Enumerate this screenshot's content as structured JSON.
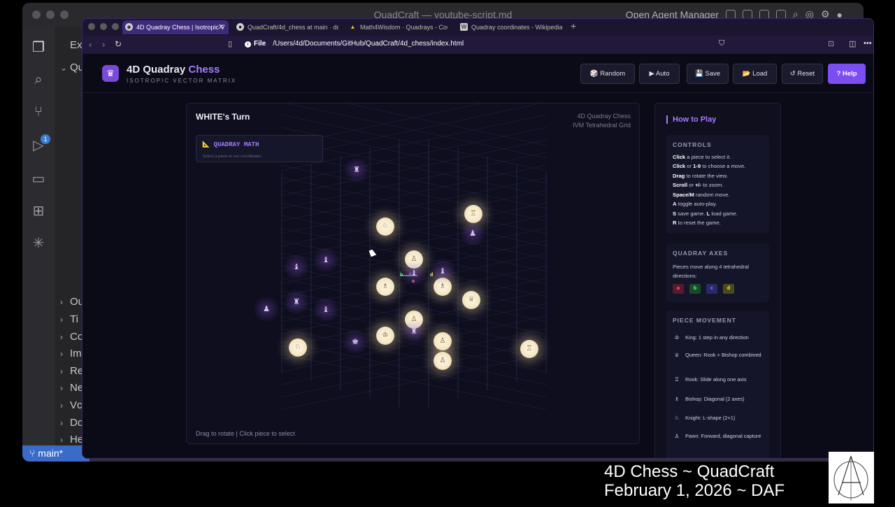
{
  "vscode": {
    "window_title": "QuadCraft — youtube-script.md",
    "right_label": "Open Agent Manager",
    "scm_badge": "1",
    "sidebar_header": "Ex",
    "sidebar_rows": [
      "Qu",
      "Ou",
      "Ti",
      "Co",
      "Im",
      "Re",
      "Ne",
      "Vc",
      "Do",
      "He"
    ],
    "branch": "main*"
  },
  "browser": {
    "tabs": [
      {
        "title": "4D Quadray Chess | Isotropic V",
        "icon": "chess-favicon",
        "active": true
      },
      {
        "title": "QuadCraft/4d_chess at main · doc",
        "icon": "github-icon",
        "active": false
      },
      {
        "title": "Math4Wisdom · Quadrays - Coda",
        "icon": "coda-icon",
        "active": false
      },
      {
        "title": "Quadray coordinates - Wikipedia",
        "icon": "wikipedia-icon",
        "active": false
      }
    ],
    "url_scheme": "File",
    "url": "/Users/4d/Documents/GitHub/QuadCraft/4d_chess/index.html"
  },
  "app": {
    "logo_icon": "♛",
    "title_main": "4D Quadray ",
    "title_accent": "Chess",
    "subtitle": "ISOTROPIC VECTOR MATRIX",
    "buttons": {
      "random": "🎲 Random",
      "auto": "▶ Auto",
      "save": "💾 Save",
      "load": "📂 Load",
      "reset": "↺ Reset",
      "help": "? Help"
    },
    "colors": {
      "accent": "#a77bff",
      "help_button": "#7c4df0"
    }
  },
  "board": {
    "turn": "WHITE's Turn",
    "meta_line1": "4D Quadray Chess",
    "meta_line2": "IVM Tetrahedral Grid",
    "quadray_math_title": "📐 QUADRAY MATH",
    "quadray_math_sub": "Select a piece to see coordinates",
    "hint": "Drag to rotate | Click piece to select",
    "axis_labels": {
      "a": "a",
      "b": "b",
      "c": "c",
      "d": "d"
    }
  },
  "help": {
    "title": "How to Play",
    "controls_header": "CONTROLS",
    "controls": [
      {
        "key": "Click",
        "text": " a piece to select it."
      },
      {
        "key": "Click",
        "text": " or ",
        "key2": "1-9",
        "text2": " to choose a move."
      },
      {
        "key": "Drag",
        "text": " to rotate the view."
      },
      {
        "key": "Scroll",
        "text": " or ",
        "key2": "+/-",
        "text2": " to zoom."
      },
      {
        "key": "Space/M",
        "text": " random move."
      },
      {
        "key": "A",
        "text": " toggle auto-play."
      },
      {
        "key": "S",
        "text": " save game. ",
        "key2": "L",
        "text2": " load game."
      },
      {
        "key": "R",
        "text": " to reset the game."
      }
    ],
    "axes_header": "QUADRAY AXES",
    "axes_desc": "Pieces move along 4 tetrahedral directions:",
    "axes": [
      {
        "label": "a",
        "bg": "#5a1a2a",
        "fg": "#ff6b8a"
      },
      {
        "label": "b",
        "bg": "#1a4a2a",
        "fg": "#6bff9a"
      },
      {
        "label": "c",
        "bg": "#2a2a6a",
        "fg": "#7b8bff"
      },
      {
        "label": "d",
        "bg": "#4a4a1a",
        "fg": "#ffee6b"
      }
    ],
    "movement_header": "PIECE MOVEMENT",
    "movement": [
      {
        "icon": "♔",
        "text": "King: 1 step in any direction"
      },
      {
        "icon": "♕",
        "text": "Queen: Rook + Bishop combined"
      },
      {
        "icon": "♖",
        "text": "Rook: Slide along one axis"
      },
      {
        "icon": "♗",
        "text": "Bishop: Diagonal (2 axes)"
      },
      {
        "icon": "♘",
        "text": "Knight: L-shape (2+1)"
      },
      {
        "icon": "♙",
        "text": "Pawn: Forward, diagonal capture"
      }
    ]
  },
  "caption": {
    "line1": "4D Chess ~ QuadCraft",
    "line2": "February 1, 2026 ~ DAF"
  }
}
